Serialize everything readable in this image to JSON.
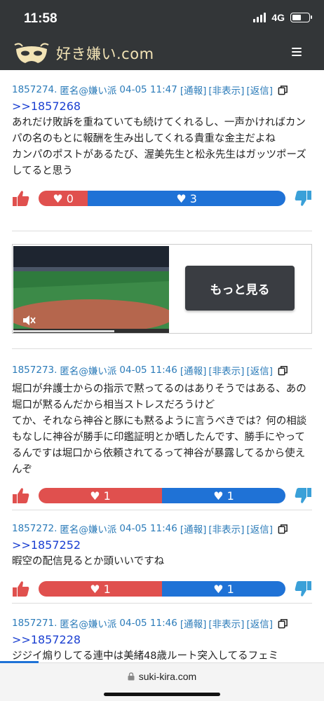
{
  "status": {
    "time": "11:58",
    "network": "4G"
  },
  "header": {
    "logo_text": "好き嫌い.com"
  },
  "posts": [
    {
      "id": "1857274.",
      "author": "匿名@嫌い派",
      "date": "04-05 11:47",
      "report": "[通報]",
      "hide": "[非表示]",
      "reply_link": "[返信]",
      "reply_to": ">>1857268",
      "body": "あれだけ敗訴を重ねていても続けてくれるし、一声かければカンパの名のもとに報酬を生み出してくれる貴重な金主だよね\nカンパのポストがあるたび、渥美先生と松永先生はガッツポーズしてると思う",
      "good": "0",
      "bad": "3",
      "good_ratio": 0.2
    },
    {
      "id": "1857273.",
      "author": "匿名@嫌い派",
      "date": "04-05 11:46",
      "report": "[通報]",
      "hide": "[非表示]",
      "reply_link": "[返信]",
      "reply_to": "",
      "body": "堀口が弁護士からの指示で黙ってるのはありそうではある、あの堀口が黙るんだから相当ストレスだろうけど\nてか、それなら神谷と豚にも黙るように言うべきでは？何の相談もなしに神谷が勝手に印鑑証明とか晒したんです、勝手にやってるんですは堀口から依頼されてるって神谷が暴露してるから使えんぞ",
      "good": "1",
      "bad": "1",
      "good_ratio": 0.5
    },
    {
      "id": "1857272.",
      "author": "匿名@嫌い派",
      "date": "04-05 11:46",
      "report": "[通報]",
      "hide": "[非表示]",
      "reply_link": "[返信]",
      "reply_to": ">>1857252",
      "body": "暇空の配信見るとか頭いいですね",
      "good": "1",
      "bad": "1",
      "good_ratio": 0.5
    },
    {
      "id": "1857271.",
      "author": "匿名@嫌い派",
      "date": "04-05 11:46",
      "report": "[通報]",
      "hide": "[非表示]",
      "reply_link": "[返信]",
      "reply_to": ">>1857228",
      "body": "ジジイ煽りしてる連中は美緒48歳ルート突入してるフェミ"
    }
  ],
  "ad": {
    "more_label": "もっと見る",
    "video_progress": 0.65
  },
  "browser": {
    "url": "suki-kira.com"
  },
  "colors": {
    "good": "#e0504e",
    "bad": "#1f72d6",
    "meta": "#2b7bb9",
    "reply": "#1a3fd1"
  }
}
